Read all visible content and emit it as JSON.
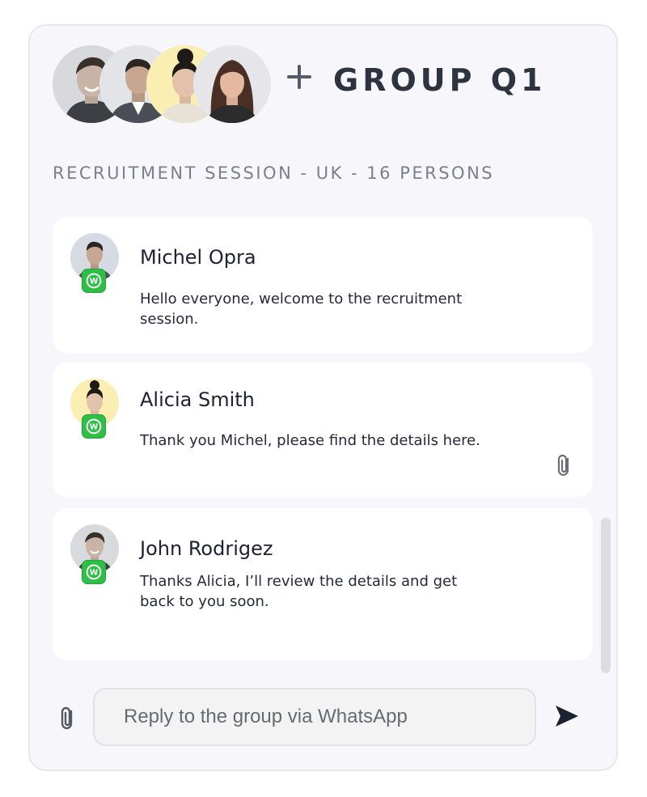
{
  "header": {
    "title": "GROUP Q1",
    "subtitle": "RECRUITMENT SESSION - UK - 16 PERSONS",
    "participants": [
      {
        "avatar": "person-avatar-smiling-man",
        "bg": "#d7d9dd"
      },
      {
        "avatar": "person-avatar-man-suit",
        "bg": "#e3e4e7"
      },
      {
        "avatar": "person-avatar-woman-bun",
        "bg": "#fbeeb2"
      },
      {
        "avatar": "person-avatar-woman-dark-hair",
        "bg": "#e6e6ea"
      }
    ]
  },
  "messages": [
    {
      "author": "Michel Opra",
      "text": "Hello everyone, welcome to the recruitment session.",
      "channel": "whatsapp",
      "has_attachment": false,
      "avatar_bg": "#d5dae3"
    },
    {
      "author": "Alicia Smith",
      "text": "Thank you Michel, please find the details here.",
      "channel": "whatsapp",
      "has_attachment": true,
      "avatar_bg": "#fbeeb2"
    },
    {
      "author": "John Rodrigez",
      "text": "Thanks Alicia, I’ll review the details and get back to you soon.",
      "channel": "whatsapp",
      "has_attachment": false,
      "avatar_bg": "#d9dadd"
    }
  ],
  "composer": {
    "placeholder": "Reply to the group via WhatsApp",
    "send_icon": "send-icon",
    "attach_icon": "paperclip-icon"
  },
  "colors": {
    "panel_bg": "#f7f7fb",
    "card_bg": "#ffffff",
    "whatsapp_green": "#2fbf47",
    "title_text": "#2e3340"
  }
}
